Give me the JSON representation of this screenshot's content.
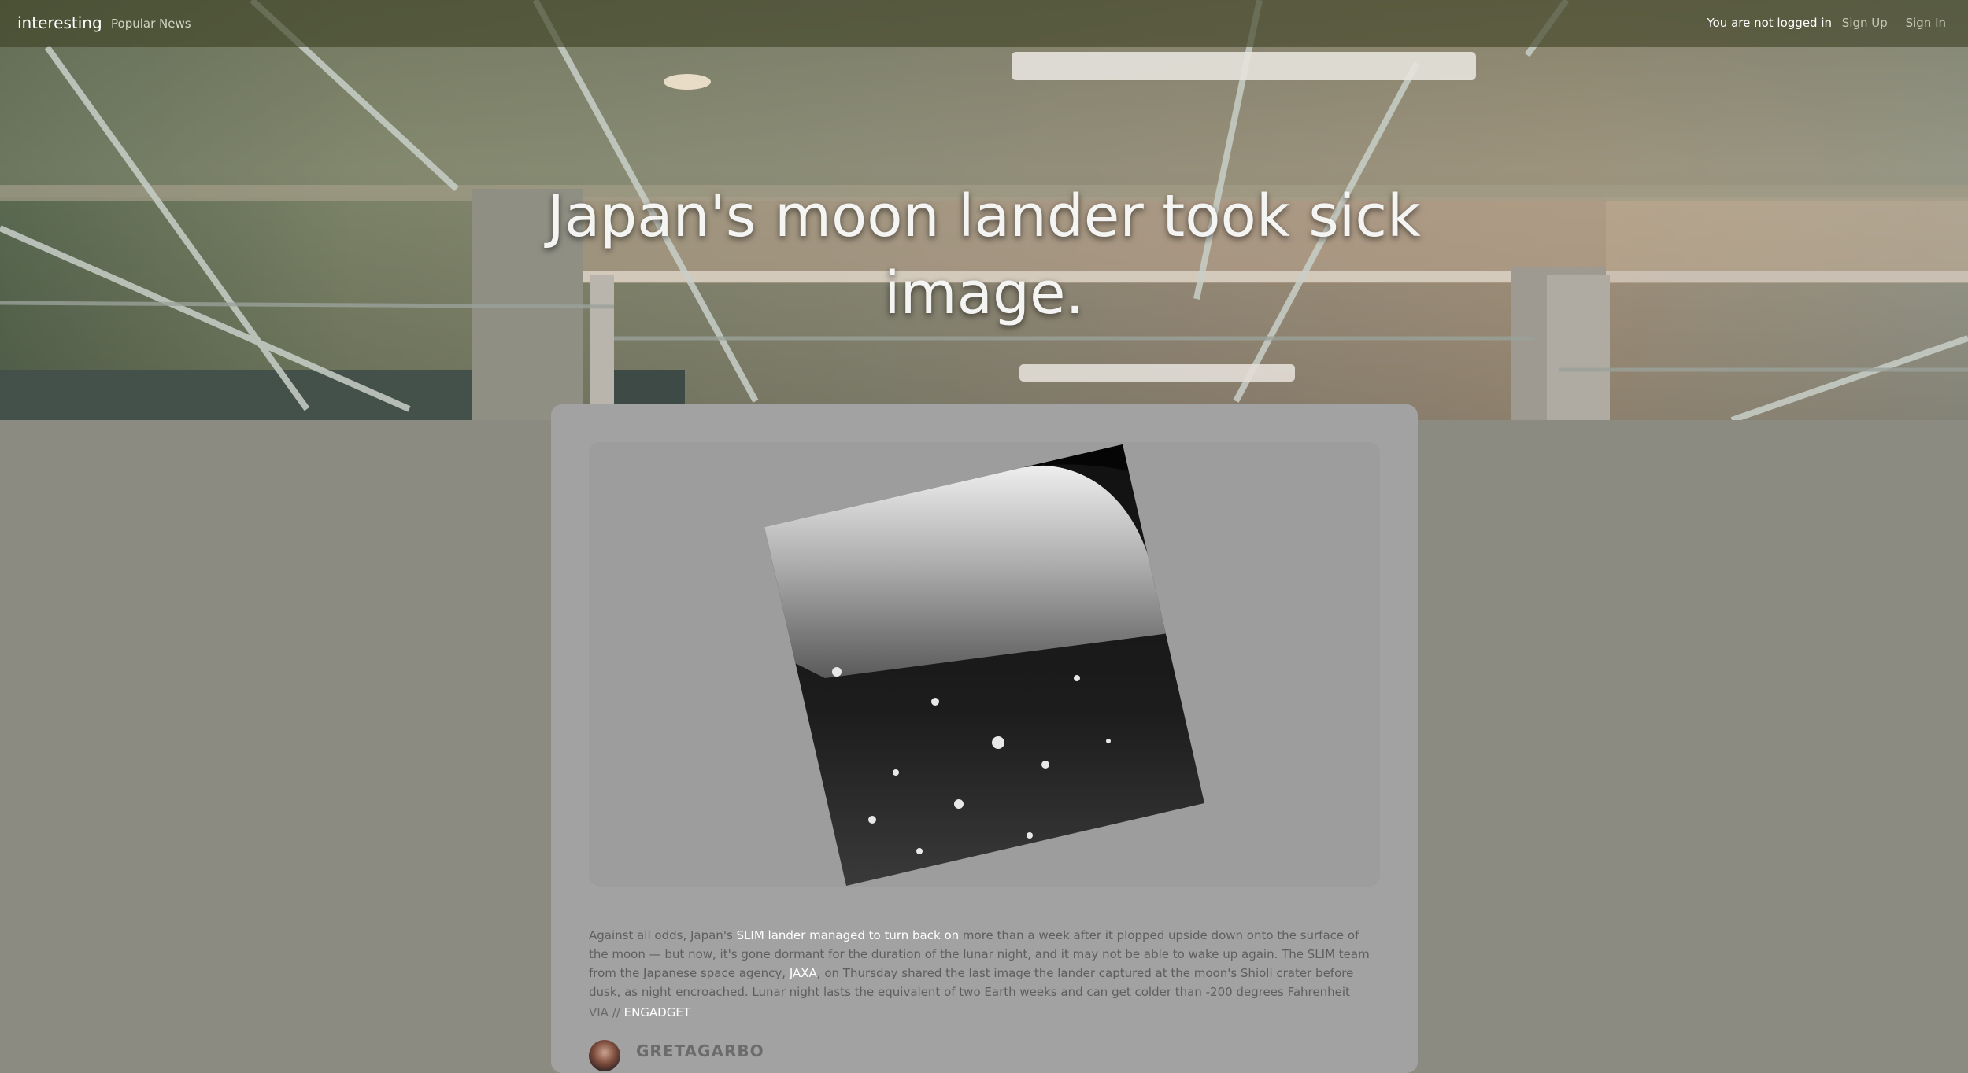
{
  "navbar": {
    "brand": "interesting",
    "popular_news": "Popular News",
    "login_status": "You are not logged in",
    "sign_up": "Sign Up",
    "sign_in": "Sign In"
  },
  "hero": {
    "title": "Japan's moon lander took sick image."
  },
  "article": {
    "text_before_link1": "Against all odds, Japan's ",
    "link1": "SLIM lander managed to turn back on",
    "text_after_link1": " more than a week after it plopped upside down onto the surface of the moon — but now, it's gone dormant for the duration of the lunar night, and it may not be able to wake up again. The SLIM team from the Japanese space agency, ",
    "link2": "JAXA",
    "text_after_link2": ", on Thursday shared the last image the lander captured at the moon's Shioli crater before dusk, as night encroached. Lunar night lasts the equivalent of two Earth weeks and can get colder than -200 degrees Fahrenheit",
    "via_prefix": "VIA // ",
    "via_source": "ENGADGET"
  },
  "author": {
    "name": "GRETAGARBO"
  },
  "colors": {
    "page_background": "#8b8b82",
    "card_background": "#a2a2a2",
    "navbar_background": "#4a4e30",
    "link_highlight": "#ffffff"
  }
}
